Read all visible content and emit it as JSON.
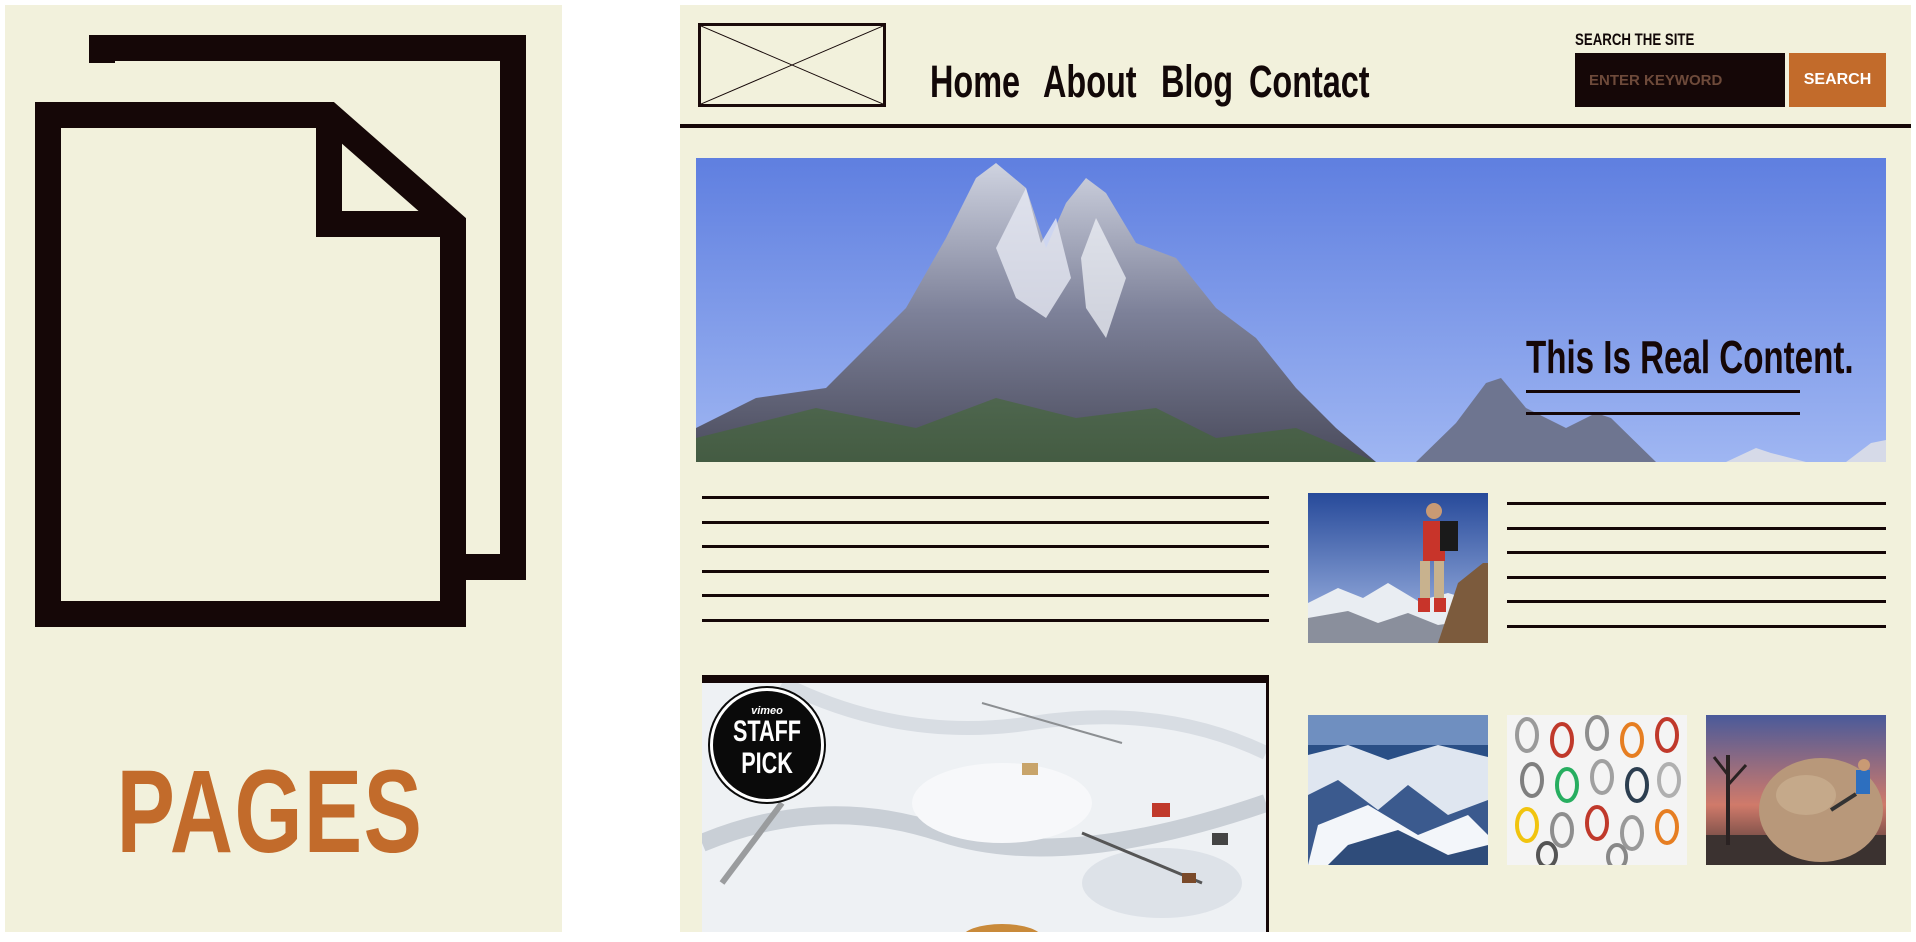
{
  "left_panel": {
    "icon": "pages-icon",
    "label": "PAGES",
    "label_color": "#c26b2b"
  },
  "site": {
    "nav": {
      "items": [
        "Home",
        "About",
        "Blog",
        "Contact"
      ]
    },
    "search": {
      "label": "SEARCH THE SITE",
      "placeholder": "ENTER KEYWORD",
      "button_label": "SEARCH",
      "button_color": "#c26b2b",
      "input_color": "#150707"
    },
    "hero": {
      "image": "mountain-peaks-image",
      "headline": "This Is Real Content."
    },
    "video": {
      "badge_brand": "vimeo",
      "badge_line1": "STAFF",
      "badge_line2": "PICK"
    },
    "thumbnails": [
      "hiker-on-summit-image",
      "snowy-range-image",
      "carabiners-image",
      "boulder-climber-image"
    ],
    "colors": {
      "background": "#f2f1dc",
      "ink": "#150707",
      "accent": "#c26b2b"
    }
  }
}
